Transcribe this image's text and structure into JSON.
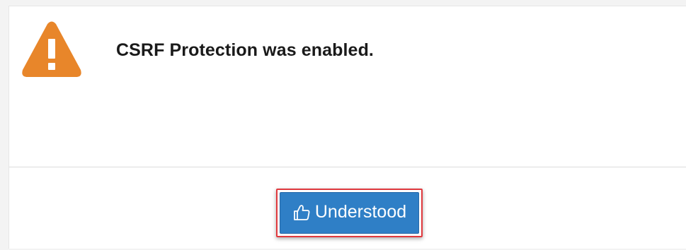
{
  "dialog": {
    "message": "CSRF Protection was enabled.",
    "icon": "warning-triangle-icon",
    "icon_color": "#e8862a",
    "button": {
      "label": "Understood",
      "icon": "thumbs-up-icon",
      "color": "#2f7fc6",
      "highlight_color": "#e0393e"
    }
  }
}
